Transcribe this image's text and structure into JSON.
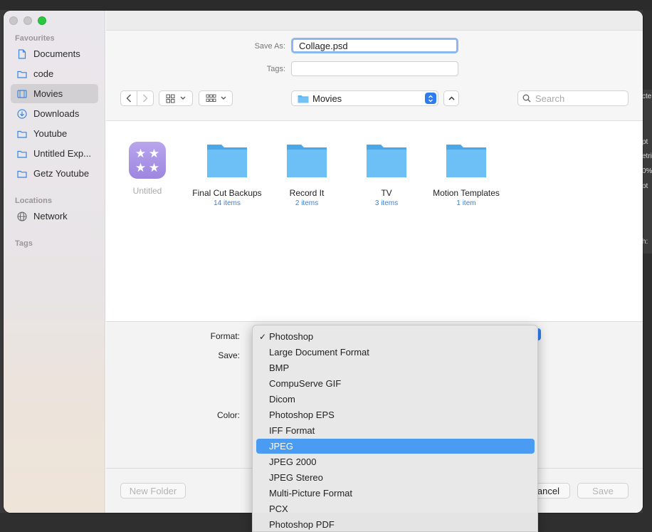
{
  "window": {
    "traffic": [
      "close",
      "minimize",
      "zoom"
    ]
  },
  "sidebar": {
    "favourites_title": "Favourites",
    "favourites": [
      {
        "label": "Documents",
        "icon": "document-icon"
      },
      {
        "label": "code",
        "icon": "folder-icon"
      },
      {
        "label": "Movies",
        "icon": "film-icon",
        "active": true
      },
      {
        "label": "Downloads",
        "icon": "download-icon"
      },
      {
        "label": "Youtube",
        "icon": "folder-icon"
      },
      {
        "label": "Untitled Exp...",
        "icon": "folder-icon"
      },
      {
        "label": "Getz Youtube",
        "icon": "folder-icon"
      }
    ],
    "locations_title": "Locations",
    "locations": [
      {
        "label": "Network",
        "icon": "globe-icon"
      }
    ],
    "tags_title": "Tags"
  },
  "save_form": {
    "save_as_label": "Save As:",
    "save_as_value": "Collage.psd",
    "tags_label": "Tags:",
    "tags_value": ""
  },
  "toolbar": {
    "location": "Movies",
    "search_placeholder": "Search"
  },
  "files": [
    {
      "name": "Untitled",
      "sub": "",
      "type": "app",
      "dim": true
    },
    {
      "name": "Final Cut Backups",
      "sub": "14 items",
      "type": "folder"
    },
    {
      "name": "Record It",
      "sub": "2 items",
      "type": "folder"
    },
    {
      "name": "TV",
      "sub": "3 items",
      "type": "folder"
    },
    {
      "name": "Motion Templates",
      "sub": "1 item",
      "type": "folder"
    }
  ],
  "options": {
    "format_label": "Format:",
    "save_label": "Save:",
    "color_label": "Color:"
  },
  "footer": {
    "new_folder": "New Folder",
    "cancel": "ancel",
    "save": "Save"
  },
  "format_menu": {
    "checked_mark": "✓",
    "items": [
      {
        "label": "Photoshop",
        "checked": true
      },
      {
        "label": "Large Document Format"
      },
      {
        "label": "BMP"
      },
      {
        "label": "CompuServe GIF"
      },
      {
        "label": "Dicom"
      },
      {
        "label": "Photoshop EPS"
      },
      {
        "label": "IFF Format"
      },
      {
        "label": "JPEG",
        "selected": true
      },
      {
        "label": "JPEG 2000"
      },
      {
        "label": "JPEG Stereo"
      },
      {
        "label": "Multi-Picture Format"
      },
      {
        "label": "PCX"
      },
      {
        "label": "Photoshop PDF"
      }
    ]
  },
  "background_panel": {
    "fragments": [
      "cte",
      "pt",
      "etri",
      "0%",
      "ot",
      "h:"
    ]
  },
  "colors": {
    "accent": "#2d7cf0",
    "selection": "#4a9cf2",
    "folder": "#5ab4f0",
    "link_blue": "#3b82d6"
  }
}
